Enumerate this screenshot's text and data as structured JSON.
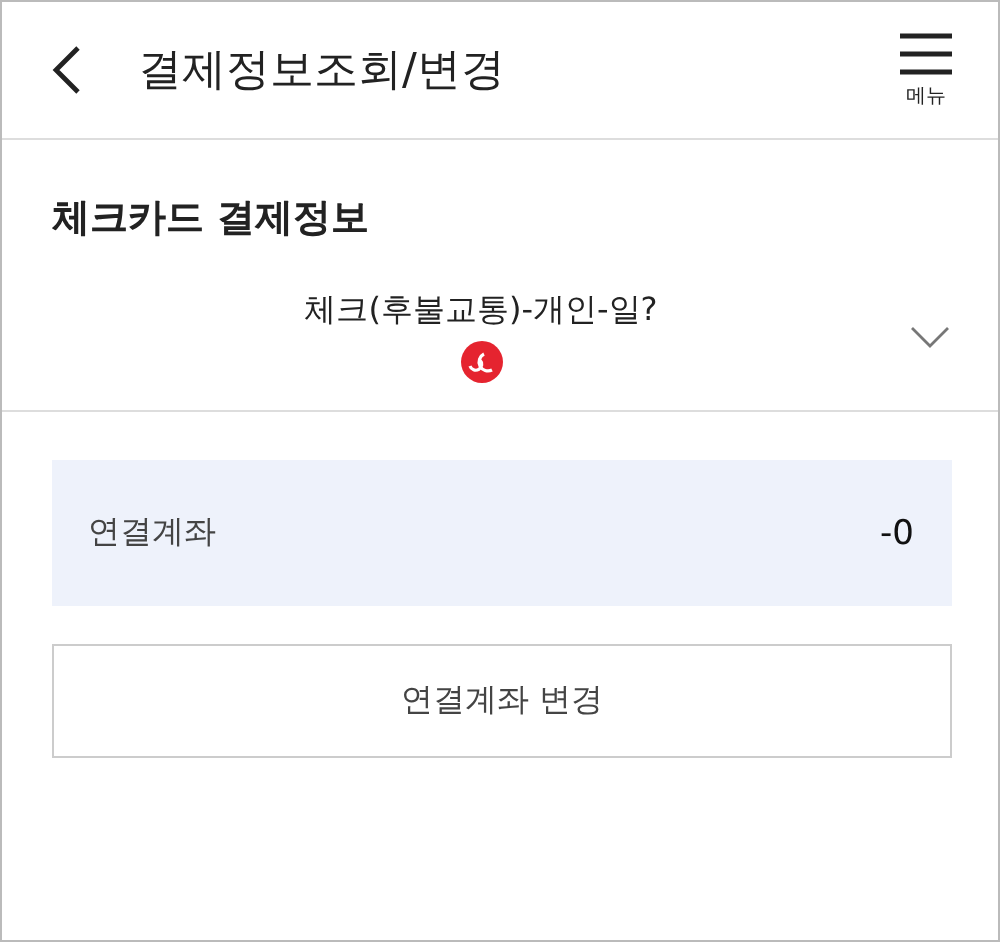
{
  "header": {
    "title": "결제정보조회/변경",
    "menu_label": "메뉴"
  },
  "section": {
    "title": "체크카드 결제정보"
  },
  "card_select": {
    "value": "체크(후불교통)-개인-일?"
  },
  "linked_account": {
    "label": "연결계좌",
    "value": "-0"
  },
  "buttons": [
    "연결계좌 변경"
  ]
}
